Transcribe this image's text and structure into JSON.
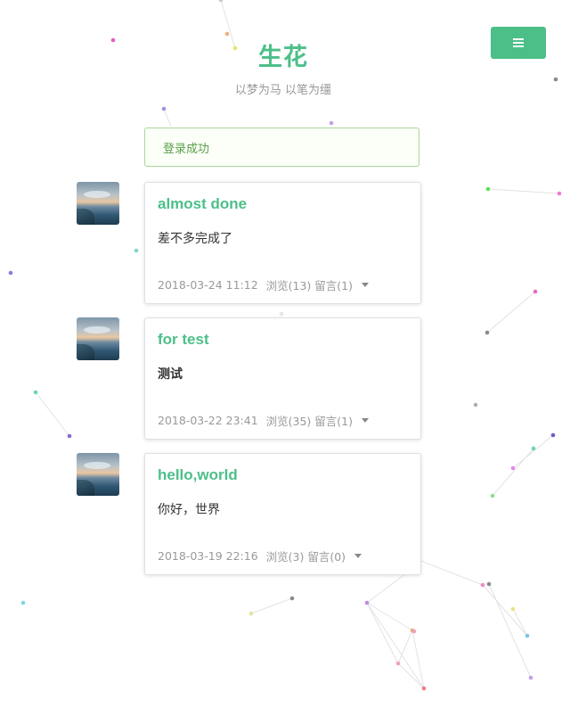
{
  "header": {
    "title": "生花",
    "subtitle": "以梦为马 以笔为缰",
    "menu_icon": "hamburger-icon",
    "accent_color": "#4cbf88"
  },
  "alert": {
    "message": "登录成功"
  },
  "posts": [
    {
      "title": "almost done",
      "excerpt": "差不多完成了",
      "date": "2018-03-24 11:12",
      "stats": "浏览(13) 留言(1)"
    },
    {
      "title": "for test",
      "excerpt": "测试",
      "date": "2018-03-22 23:41",
      "stats": "浏览(35) 留言(1)"
    },
    {
      "title": "hello,world",
      "excerpt": "你好，世界",
      "date": "2018-03-19 22:16",
      "stats": "浏览(3) 留言(0)"
    }
  ]
}
